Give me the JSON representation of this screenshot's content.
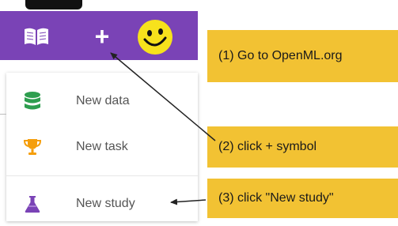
{
  "colors": {
    "navbar": "#7a43b6",
    "callout": "#f2c233",
    "data_icon": "#2e9e4f",
    "task_icon": "#f59e0b",
    "study_icon": "#7a43b6"
  },
  "navbar": {
    "icons": [
      "book-icon",
      "plus-icon",
      "smiley-avatar-icon"
    ],
    "plus_glyph": "+"
  },
  "menu": {
    "items": [
      {
        "label": "New data",
        "icon": "database-icon"
      },
      {
        "label": "New task",
        "icon": "trophy-icon"
      },
      {
        "label": "New study",
        "icon": "flask-icon"
      }
    ]
  },
  "callouts": [
    {
      "text": "(1) Go to OpenML.org"
    },
    {
      "text": "(2) click + symbol"
    },
    {
      "text": "(3) click \"New study\""
    }
  ]
}
